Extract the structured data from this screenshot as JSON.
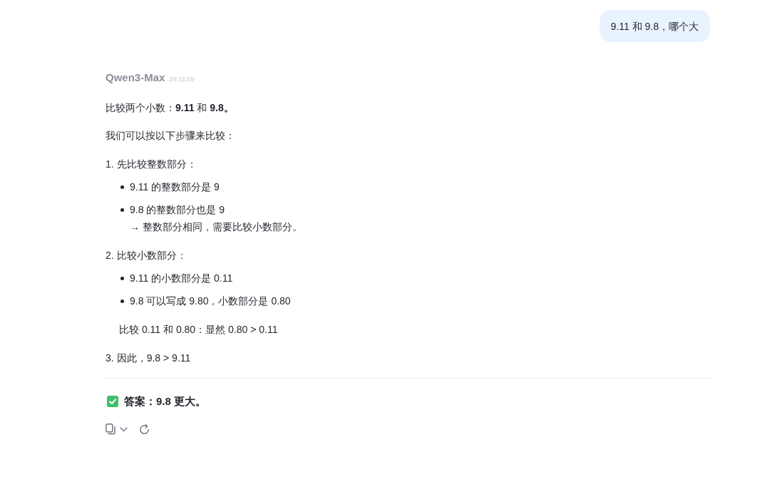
{
  "user_message": {
    "text": "9.11 和 9.8，哪个大"
  },
  "response": {
    "model": "Qwen3-Max",
    "time": "20:15:09",
    "paragraphs": [
      "比较两个小数：**9.11** 和 **9.8。**",
      "我们可以按以下步骤来比较："
    ],
    "steps": [
      {
        "number": "1.",
        "text": "先比较整数部分：",
        "bullets": [
          {
            "lines": [
              "9.11 的整数部分是 9"
            ]
          },
          {
            "lines": [
              "9.8 的整数部分也是 9",
              "→ 整数部分相同，需要比较小数部分。"
            ]
          }
        ]
      },
      {
        "number": "2.",
        "text": "比较小数部分：",
        "bullets": [
          {
            "lines": [
              "9.11 的小数部分是 0.11"
            ]
          },
          {
            "lines": [
              "9.8 可以写成 9.80，小数部分是 0.80"
            ]
          }
        ],
        "note": "比较 0.11 和 0.80：显然 0.80 > 0.11"
      },
      {
        "number": "3.",
        "text": "因此，9.8 > 9.11"
      }
    ],
    "answer": {
      "text": "答案：9.8 更大。"
    }
  }
}
